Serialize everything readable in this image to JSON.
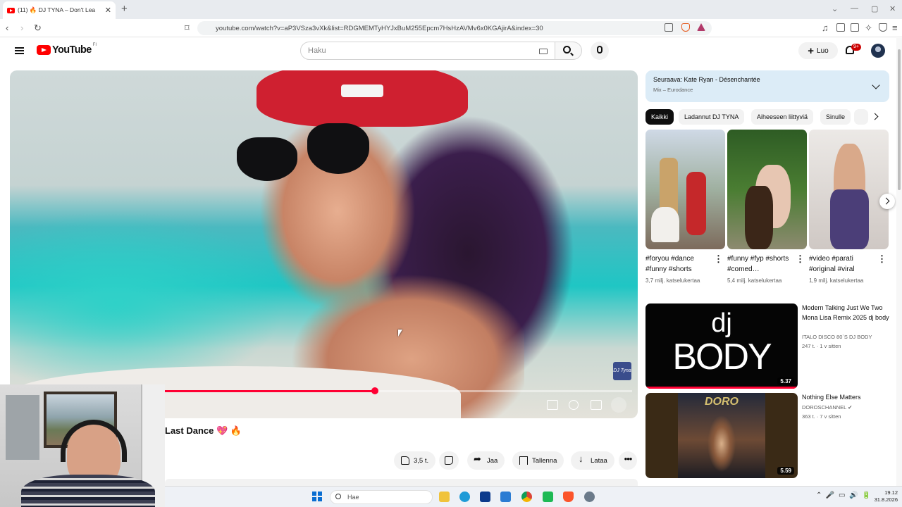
{
  "browser": {
    "tab_title": "(11) 🔥 DJ TYNA – Don't Lea",
    "url": "youtube.com/watch?v=aP3VSza3vXk&list=RDGMEMTyHYJxBuM255Epcm7HsHzAVMv6x0KGAjirA&index=30"
  },
  "header": {
    "logo": "YouTube",
    "region": "FI",
    "search_placeholder": "Haku",
    "create_label": "Luo",
    "notifications": "9+"
  },
  "player": {
    "watermark": "DJ Tyna",
    "progress_fraction": 0.45
  },
  "video": {
    "title": "Last Dance 💖 🔥",
    "actions": {
      "like_count": "3,5 t.",
      "share": "Jaa",
      "save": "Tallenna",
      "download": "Lataa"
    }
  },
  "up_next": {
    "label": "Seuraava: Kate Ryan - Désenchantée",
    "playlist": "Mix – Eurodance"
  },
  "chips": [
    "Kaikki",
    "Ladannut DJ TYNA",
    "Aiheeseen liittyviä",
    "Sinulle"
  ],
  "shorts": [
    {
      "title": "#foryou #dance #funny #shorts",
      "views": "3,7 milj. katselukertaa"
    },
    {
      "title": "#funny #fyp #shorts #comed…",
      "views": "5,4 milj. katselukertaa"
    },
    {
      "title": "#video #parati #original #viral",
      "views": "1,9 milj. katselukertaa"
    }
  ],
  "recommendations": [
    {
      "title": "Modern Talking  Just We Two Mona Lisa Remix 2025 dj body",
      "channel": "ITALO DISCO 80`S DJ BODY",
      "meta": "247 t. · 1 v sitten",
      "duration": "5.37",
      "thumb_text_1": "dj",
      "thumb_text_2": "BODY"
    },
    {
      "title": "Nothing Else Matters",
      "channel": "DOROSCHANNEL ✔",
      "meta": "363 t. · 7 v sitten",
      "duration": "5.59",
      "thumb_text_1": "DORO"
    }
  ],
  "taskbar": {
    "search_placeholder": "Hae",
    "time": "19.12",
    "date": "31.8.2026"
  },
  "colors": {
    "accent": "#ff0033",
    "upnext_bg": "#dcecf7",
    "chip_active": "#0f0f0f"
  }
}
